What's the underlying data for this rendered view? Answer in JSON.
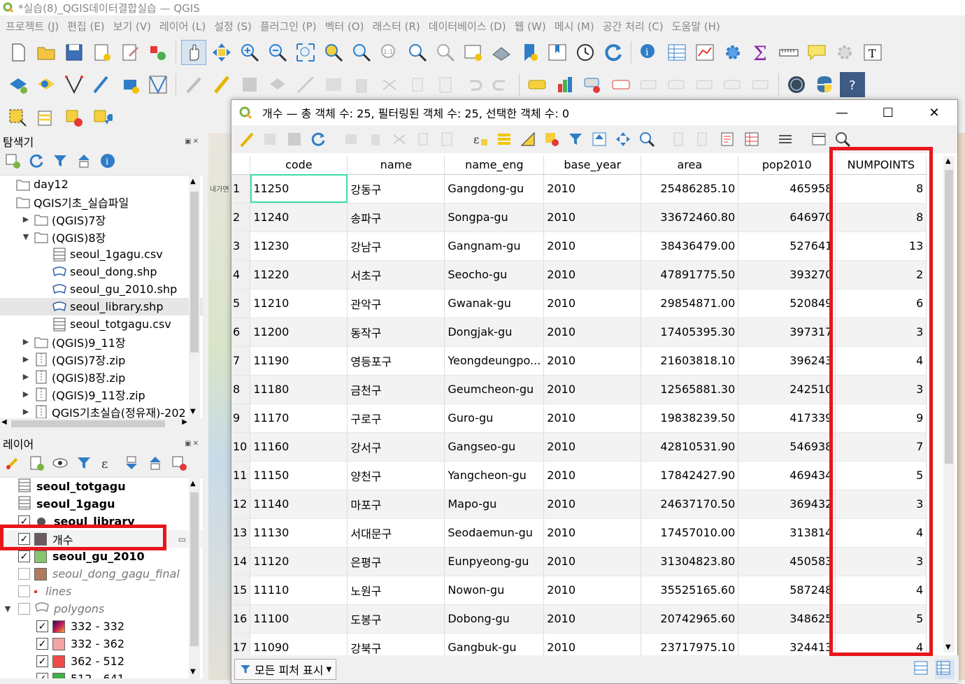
{
  "app": {
    "title": "*실습(8)_QGIS데이터결합실습 — QGIS",
    "menu": [
      "프로젝트 (J)",
      "편집 (E)",
      "보기 (V)",
      "레이어 (L)",
      "설정 (S)",
      "플러그인 (P)",
      "벡터 (O)",
      "래스터 (R)",
      "데이터베이스 (D)",
      "웹 (W)",
      "메시 (M)",
      "공간 처리 (C)",
      "도움말 (H)"
    ]
  },
  "browser": {
    "title": "탐색기",
    "items": [
      {
        "label": "day12",
        "depth": 0,
        "arrow": "",
        "icon": "folder-icon"
      },
      {
        "label": "QGIS기초_실습파일",
        "depth": 0,
        "arrow": "",
        "icon": "folder-icon"
      },
      {
        "label": "(QGIS)7장",
        "depth": 1,
        "arrow": "▶",
        "icon": "folder-icon"
      },
      {
        "label": "(QGIS)8장",
        "depth": 1,
        "arrow": "▼",
        "icon": "folder-icon"
      },
      {
        "label": "seoul_1gagu.csv",
        "depth": 2,
        "arrow": "",
        "icon": "table-icon"
      },
      {
        "label": "seoul_dong.shp",
        "depth": 2,
        "arrow": "",
        "icon": "polygon-icon"
      },
      {
        "label": "seoul_gu_2010.shp",
        "depth": 2,
        "arrow": "",
        "icon": "polygon-icon"
      },
      {
        "label": "seoul_library.shp",
        "depth": 2,
        "arrow": "",
        "icon": "polygon-icon"
      },
      {
        "label": "seoul_totgagu.csv",
        "depth": 2,
        "arrow": "",
        "icon": "table-icon"
      },
      {
        "label": "(QGIS)9_11장",
        "depth": 1,
        "arrow": "▶",
        "icon": "folder-icon"
      },
      {
        "label": "(QGIS)7장.zip",
        "depth": 1,
        "arrow": "▶",
        "icon": "zip-icon"
      },
      {
        "label": "(QGIS)8장.zip",
        "depth": 1,
        "arrow": "▶",
        "icon": "zip-icon"
      },
      {
        "label": "(QGIS)9_11장.zip",
        "depth": 1,
        "arrow": "▶",
        "icon": "zip-icon"
      },
      {
        "label": "QGIS기초실습(정유재)-202",
        "depth": 1,
        "arrow": "▶",
        "icon": "zip-icon"
      }
    ]
  },
  "layers": {
    "title": "레이어",
    "items": [
      {
        "label": "seoul_totgagu",
        "kind": "table",
        "checked": null,
        "style": "bold"
      },
      {
        "label": "seoul_1gagu",
        "kind": "table",
        "checked": null,
        "style": "bold"
      },
      {
        "label": "seoul_library",
        "kind": "point",
        "checked": true,
        "style": "bold"
      },
      {
        "label": "개수",
        "kind": "swatch",
        "color": "#6b5b5e",
        "checked": true,
        "style": "normal"
      },
      {
        "label": "seoul_gu_2010",
        "kind": "swatch",
        "color": "#86c46e",
        "checked": true,
        "style": "bold"
      },
      {
        "label": "seoul_dong_gagu_final",
        "kind": "swatch",
        "color": "#b07a5e",
        "checked": false,
        "style": "italic"
      },
      {
        "label": "lines",
        "kind": "line",
        "checked": false,
        "style": "italic"
      },
      {
        "label": "polygons",
        "kind": "group",
        "checked": false,
        "style": "italic"
      },
      {
        "label": "332 - 332",
        "kind": "swatch-gradient",
        "checked": true,
        "style": "normal"
      },
      {
        "label": "332 - 362",
        "kind": "swatch",
        "color": "#f5a3a3",
        "checked": true,
        "style": "normal"
      },
      {
        "label": "362 - 512",
        "kind": "swatch",
        "color": "#f04a4a",
        "checked": true,
        "style": "normal"
      },
      {
        "label": "512 - 641",
        "kind": "swatch",
        "color": "#3cb043",
        "checked": true,
        "style": "normal"
      }
    ]
  },
  "attribute_table": {
    "title": "개수 — 총 객체 수: 25, 필터링된 객체 수: 25, 선택한 객체 수: 0",
    "columns": [
      "code",
      "name",
      "name_eng",
      "base_year",
      "area",
      "pop2010",
      "NUMPOINTS"
    ],
    "rows": [
      [
        "1",
        "11250",
        "강동구",
        "Gangdong-gu",
        "2010",
        "25486285.10",
        "465958",
        "8"
      ],
      [
        "2",
        "11240",
        "송파구",
        "Songpa-gu",
        "2010",
        "33672460.80",
        "646970",
        "8"
      ],
      [
        "3",
        "11230",
        "강남구",
        "Gangnam-gu",
        "2010",
        "38436479.00",
        "527641",
        "13"
      ],
      [
        "4",
        "11220",
        "서초구",
        "Seocho-gu",
        "2010",
        "47891775.50",
        "393270",
        "2"
      ],
      [
        "5",
        "11210",
        "관악구",
        "Gwanak-gu",
        "2010",
        "29854871.00",
        "520849",
        "6"
      ],
      [
        "6",
        "11200",
        "동작구",
        "Dongjak-gu",
        "2010",
        "17405395.30",
        "397317",
        "3"
      ],
      [
        "7",
        "11190",
        "영등포구",
        "Yeongdeungpo...",
        "2010",
        "21603818.10",
        "396243",
        "4"
      ],
      [
        "8",
        "11180",
        "금천구",
        "Geumcheon-gu",
        "2010",
        "12565881.30",
        "242510",
        "3"
      ],
      [
        "9",
        "11170",
        "구로구",
        "Guro-gu",
        "2010",
        "19838239.50",
        "417339",
        "9"
      ],
      [
        "10",
        "11160",
        "강서구",
        "Gangseo-gu",
        "2010",
        "42810531.90",
        "546938",
        "7"
      ],
      [
        "11",
        "11150",
        "양천구",
        "Yangcheon-gu",
        "2010",
        "17842427.90",
        "469434",
        "5"
      ],
      [
        "12",
        "11140",
        "마포구",
        "Mapo-gu",
        "2010",
        "24637170.50",
        "369432",
        "3"
      ],
      [
        "13",
        "11130",
        "서대문구",
        "Seodaemun-gu",
        "2010",
        "17457010.00",
        "313814",
        "4"
      ],
      [
        "14",
        "11120",
        "은평구",
        "Eunpyeong-gu",
        "2010",
        "31304823.80",
        "450583",
        "3"
      ],
      [
        "15",
        "11110",
        "노원구",
        "Nowon-gu",
        "2010",
        "35525165.60",
        "587248",
        "4"
      ],
      [
        "16",
        "11100",
        "도봉구",
        "Dobong-gu",
        "2010",
        "20742965.60",
        "348625",
        "5"
      ],
      [
        "17",
        "11090",
        "강북구",
        "Gangbuk-gu",
        "2010",
        "23717975.10",
        "324413",
        "4"
      ]
    ],
    "filter_button": "모든 피처 표시",
    "map_label": "내가면"
  },
  "colors": {
    "highlight_red": "#e8161c",
    "focus_green": "#3adfa0"
  }
}
